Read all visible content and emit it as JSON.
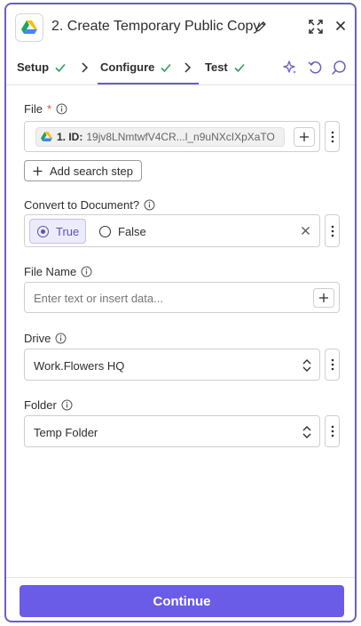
{
  "header": {
    "title": "2. Create Temporary Public Copy"
  },
  "tabs": [
    {
      "label": "Setup",
      "done": true
    },
    {
      "label": "Configure",
      "done": true,
      "active": true
    },
    {
      "label": "Test",
      "done": true
    }
  ],
  "fields": {
    "file": {
      "label": "File",
      "required": "*",
      "chip_prefix": "1. ID:",
      "chip_value": "19jv8LNmtwfV4CR...l_n9uNXcIXpXaTO",
      "add_search_step": "Add search step"
    },
    "convert": {
      "label": "Convert to Document?",
      "option_true": "True",
      "option_false": "False",
      "selected": "True"
    },
    "file_name": {
      "label": "File Name",
      "placeholder": "Enter text or insert data..."
    },
    "drive": {
      "label": "Drive",
      "value": "Work.Flowers HQ"
    },
    "folder": {
      "label": "Folder",
      "value": "Temp Folder"
    }
  },
  "footer": {
    "continue_label": "Continue"
  },
  "colors": {
    "accent": "#6b5ce7",
    "check": "#2e9e57",
    "required": "#d9591c"
  },
  "icons": [
    "google-drive-icon",
    "pencil-icon",
    "expand-icon",
    "close-icon",
    "check-icon",
    "chevron-right-icon",
    "sparkle-icon",
    "undo-icon",
    "comment-icon",
    "info-icon",
    "plus-icon",
    "more-vertical-icon",
    "clear-icon",
    "updown-icon"
  ]
}
